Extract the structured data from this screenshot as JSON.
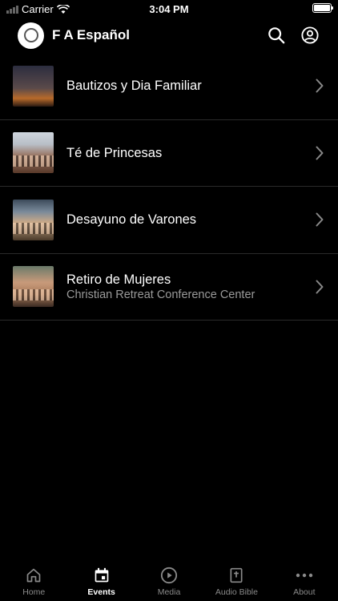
{
  "status_bar": {
    "carrier": "Carrier",
    "time": "3:04 PM"
  },
  "header": {
    "title": "F A Español",
    "search_icon": "search-icon",
    "profile_icon": "account-circle-icon"
  },
  "events": [
    {
      "title": "Bautizos y Dia Familiar",
      "subtitle": ""
    },
    {
      "title": "Té de Princesas",
      "subtitle": ""
    },
    {
      "title": "Desayuno de Varones",
      "subtitle": ""
    },
    {
      "title": "Retiro de Mujeres",
      "subtitle": "Christian Retreat Conference Center"
    }
  ],
  "tabs": [
    {
      "label": "Home",
      "icon": "home-icon",
      "active": false
    },
    {
      "label": "Events",
      "icon": "calendar-icon",
      "active": true
    },
    {
      "label": "Media",
      "icon": "play-circle-icon",
      "active": false
    },
    {
      "label": "Audio Bible",
      "icon": "bible-icon",
      "active": false
    },
    {
      "label": "About",
      "icon": "more-horizontal-icon",
      "active": false
    }
  ],
  "colors": {
    "background": "#000000",
    "text_primary": "#ffffff",
    "text_secondary": "#9a9a9a",
    "divider": "#2a2a2a",
    "tab_inactive": "#8a8a8a"
  }
}
